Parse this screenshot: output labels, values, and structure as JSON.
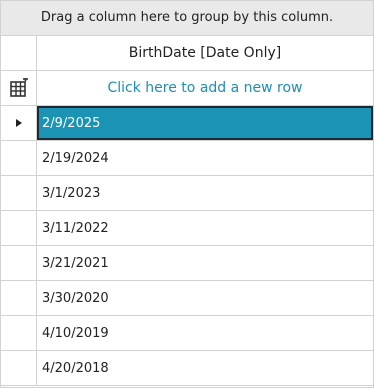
{
  "group_panel": {
    "text": "Drag a column here to group by this column."
  },
  "columns": [
    {
      "header": "BirthDate [Date Only]"
    }
  ],
  "add_row": {
    "text": "Click here to add a new row",
    "icon": "add-row-icon"
  },
  "selected_row_index": 0,
  "rows": [
    {
      "birthdate": "2/9/2025"
    },
    {
      "birthdate": "2/19/2024"
    },
    {
      "birthdate": "3/1/2023"
    },
    {
      "birthdate": "3/11/2022"
    },
    {
      "birthdate": "3/21/2021"
    },
    {
      "birthdate": "3/30/2020"
    },
    {
      "birthdate": "4/10/2019"
    },
    {
      "birthdate": "4/20/2018"
    }
  ],
  "colors": {
    "selection": "#1a93b5",
    "link": "#1b8fb4"
  }
}
